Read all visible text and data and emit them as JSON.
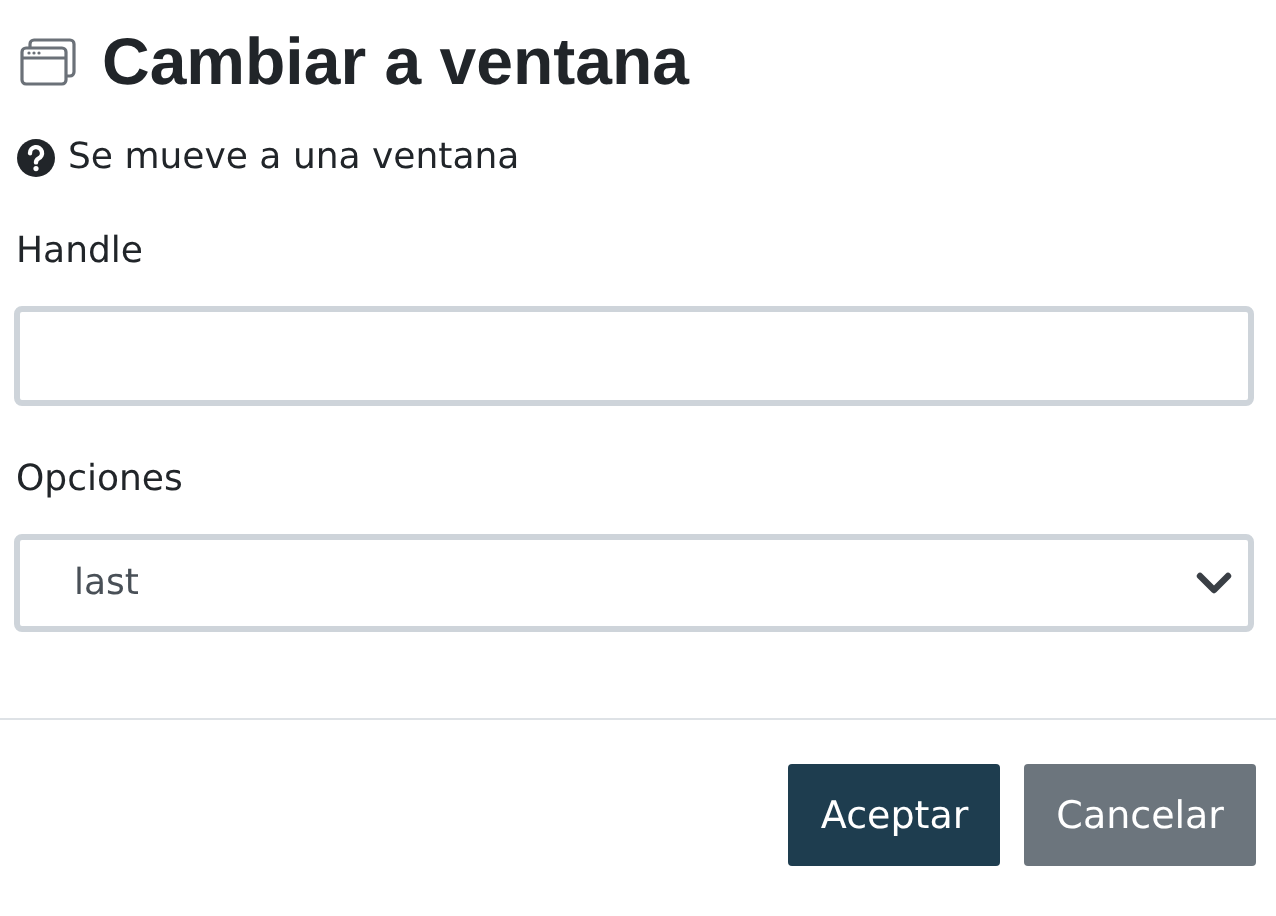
{
  "dialog": {
    "title": "Cambiar a ventana",
    "description": "Se mueve a una ventana"
  },
  "fields": [
    {
      "kind": "text",
      "label": "Handle"
    },
    {
      "kind": "select",
      "label": "Opciones",
      "value": "last"
    }
  ],
  "buttons": [
    {
      "label": "Aceptar",
      "kind": "primary"
    },
    {
      "label": "Cancelar",
      "kind": "secondary"
    }
  ]
}
